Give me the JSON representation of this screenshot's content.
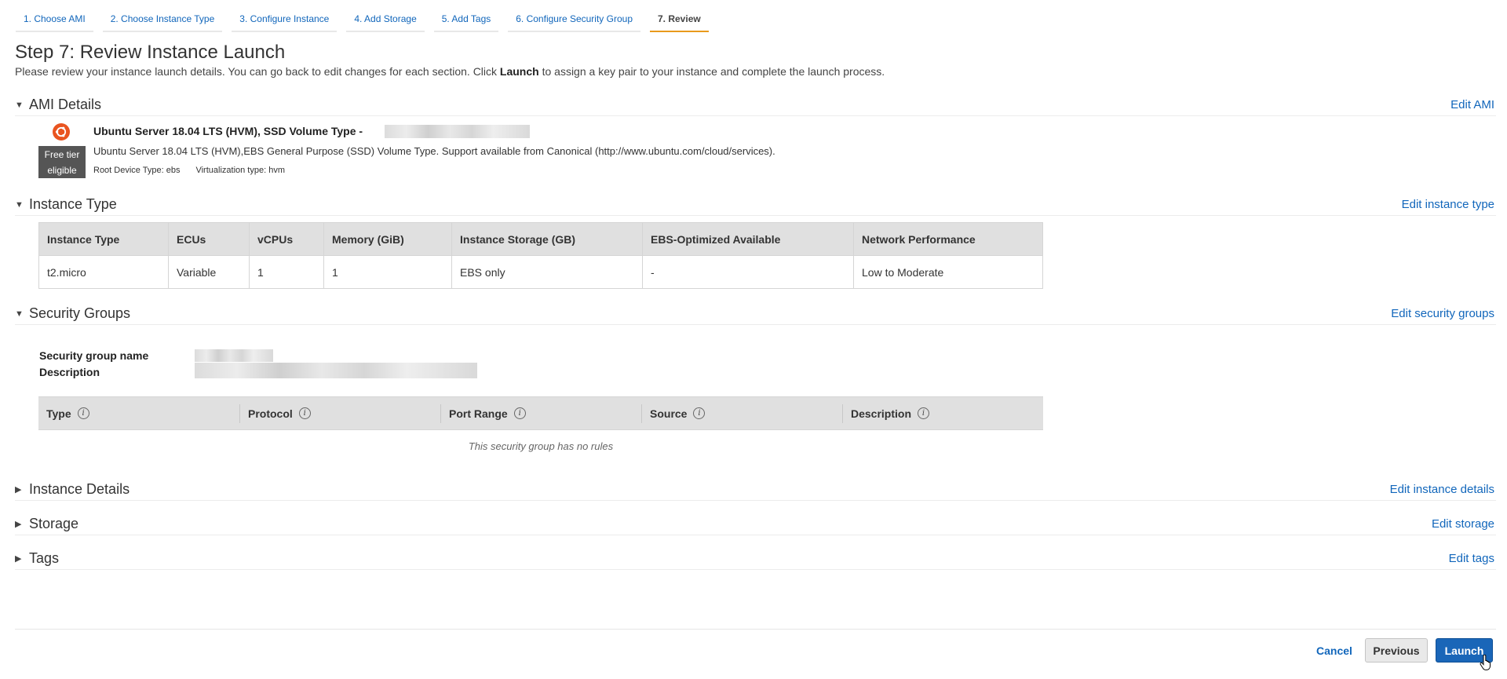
{
  "wizard": {
    "steps": [
      "1. Choose AMI",
      "2. Choose Instance Type",
      "3. Configure Instance",
      "4. Add Storage",
      "5. Add Tags",
      "6. Configure Security Group",
      "7. Review"
    ],
    "active_index": 6
  },
  "page": {
    "title": "Step 7: Review Instance Launch",
    "intro_before": "Please review your instance launch details. You can go back to edit changes for each section. Click ",
    "intro_bold": "Launch",
    "intro_after": " to assign a key pair to your instance and complete the launch process."
  },
  "sections": {
    "ami": {
      "title": "AMI Details",
      "edit": "Edit AMI"
    },
    "instance_type": {
      "title": "Instance Type",
      "edit": "Edit instance type"
    },
    "security_groups": {
      "title": "Security Groups",
      "edit": "Edit security groups"
    },
    "instance_details": {
      "title": "Instance Details",
      "edit": "Edit instance details"
    },
    "storage": {
      "title": "Storage",
      "edit": "Edit storage"
    },
    "tags": {
      "title": "Tags",
      "edit": "Edit tags"
    }
  },
  "ami": {
    "icon": "ubuntu-icon",
    "free_tier_line1": "Free tier",
    "free_tier_line2": "eligible",
    "name": "Ubuntu Server 18.04 LTS (HVM), SSD Volume Type - ",
    "description": "Ubuntu Server 18.04 LTS (HVM),EBS General Purpose (SSD) Volume Type. Support available from Canonical (http://www.ubuntu.com/cloud/services).",
    "root_device": "Root Device Type: ebs",
    "virtualization": "Virtualization type: hvm"
  },
  "instance_type_table": {
    "headers": [
      "Instance Type",
      "ECUs",
      "vCPUs",
      "Memory (GiB)",
      "Instance Storage (GB)",
      "EBS-Optimized Available",
      "Network Performance"
    ],
    "row": [
      "t2.micro",
      "Variable",
      "1",
      "1",
      "EBS only",
      "-",
      "Low to Moderate"
    ]
  },
  "security_group": {
    "name_label": "Security group name",
    "description_label": "Description",
    "rules_headers": [
      "Type",
      "Protocol",
      "Port Range",
      "Source",
      "Description"
    ],
    "empty_message": "This security group has no rules"
  },
  "footer": {
    "cancel": "Cancel",
    "previous": "Previous",
    "launch": "Launch"
  },
  "colors": {
    "link": "#1166bb",
    "active_tab_underline": "#e99a1c",
    "primary_button": "#1a66b8",
    "ubuntu": "#e95420"
  }
}
